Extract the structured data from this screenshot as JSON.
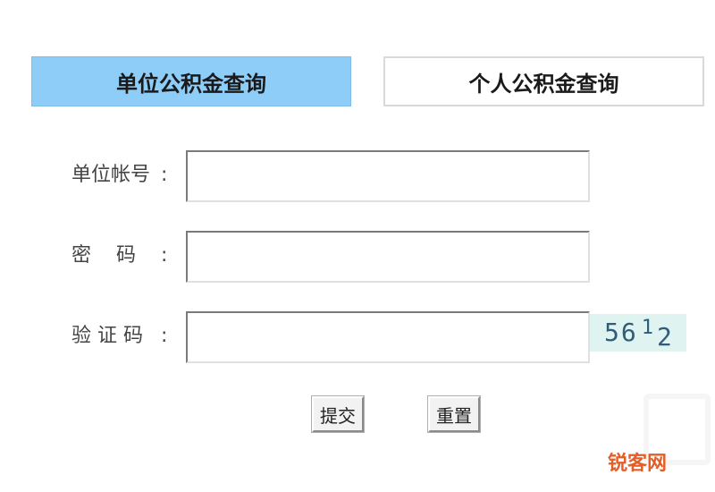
{
  "tabs": {
    "unit_query": "单位公积金查询",
    "personal_query": "个人公积金查询"
  },
  "form": {
    "account_label": "单位帐号",
    "password_label": "密    码",
    "captcha_label": "验 证 码",
    "colon": ":",
    "account_value": "",
    "password_value": "",
    "captcha_value": ""
  },
  "captcha": {
    "digits": [
      "5",
      "6",
      "1",
      "2"
    ]
  },
  "buttons": {
    "submit": "提交",
    "reset": "重置"
  },
  "watermark": {
    "text": "锐客网"
  },
  "colors": {
    "active_tab": "#8ecdf8",
    "captcha_bg": "#dff3f1",
    "captcha_text": "#2f5c78",
    "watermark": "#e4551c"
  }
}
